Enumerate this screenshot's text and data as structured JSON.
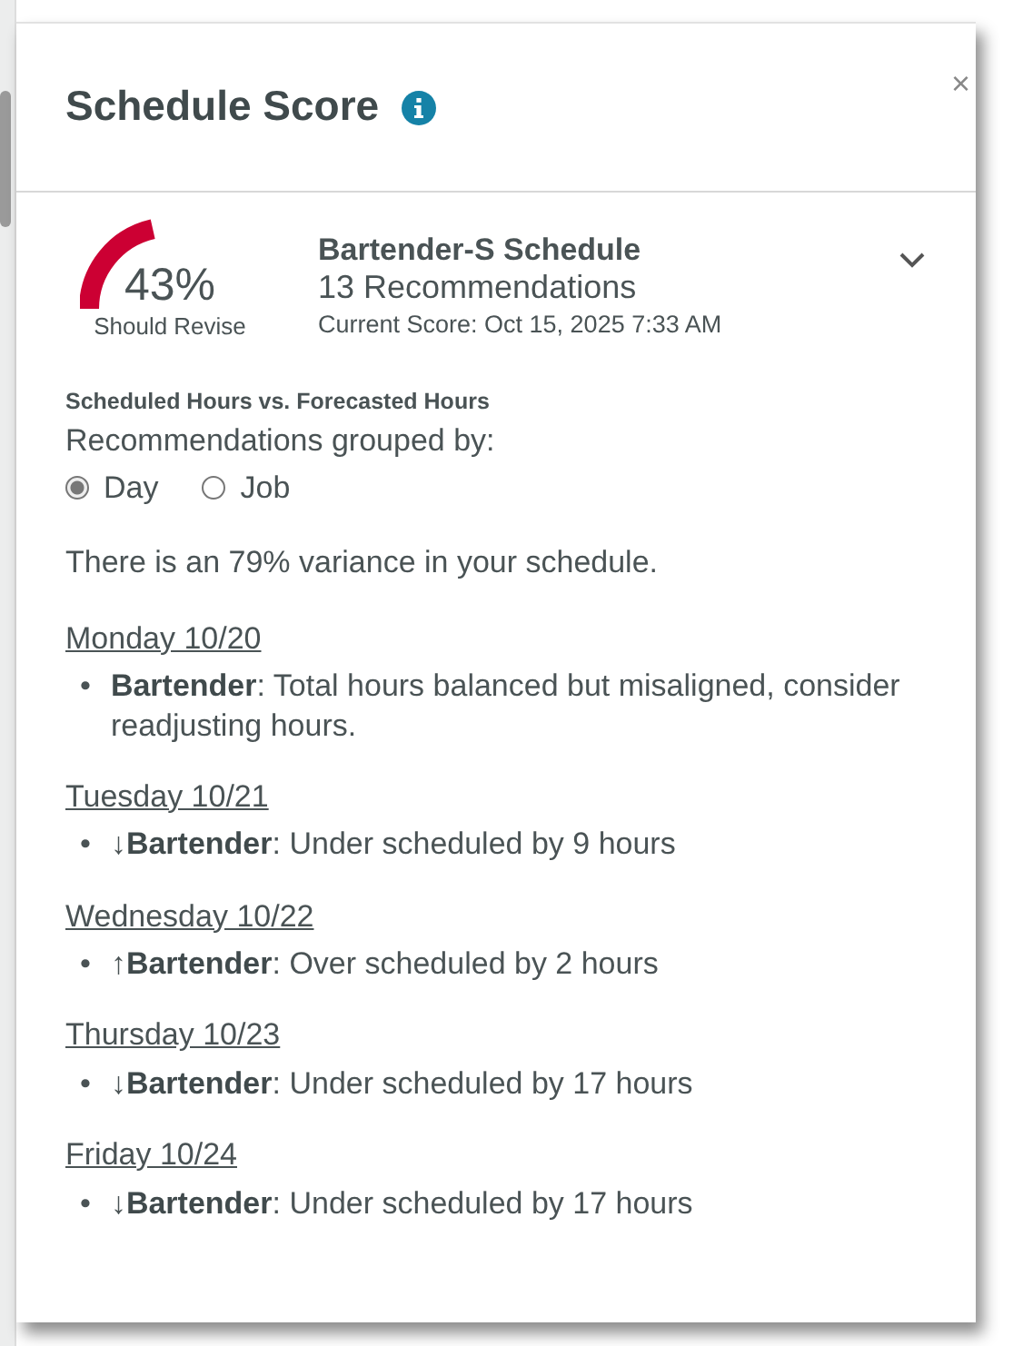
{
  "panel": {
    "title": "Schedule Score",
    "close": "×"
  },
  "score": {
    "percent": "43%",
    "rating": "Should Revise",
    "schedule_name": "Bartender-S Schedule",
    "recommendations": "13 Recommendations",
    "current_score": "Current Score: Oct 15, 2025 7:33 AM",
    "expanded": false
  },
  "section_title": "Scheduled Hours vs. Forecasted Hours",
  "group_label": "Recommendations grouped by:",
  "group_options": [
    {
      "label": "Day",
      "selected": true
    },
    {
      "label": "Job",
      "selected": false
    }
  ],
  "variance": "There is an 79% variance in your schedule.",
  "days": [
    {
      "date": "Monday 10/20",
      "items": [
        {
          "bullet": "•",
          "text": "**Bartender**: Total hours balanced but misaligned, consider readjusting hours."
        }
      ]
    },
    {
      "date": "Tuesday 10/21",
      "items": [
        {
          "bullet": "•",
          "text": "↓**Bartender**: Under scheduled by 9 hours"
        }
      ]
    },
    {
      "date": "Wednesday 10/22",
      "items": [
        {
          "bullet": "•",
          "text": "↑**Bartender**: Over scheduled by 2 hours"
        }
      ]
    },
    {
      "date": "Thursday 10/23",
      "items": [
        {
          "bullet": "•",
          "text": "↓**Bartender**: Under scheduled by 17 hours"
        }
      ]
    },
    {
      "date": "Friday 10/24",
      "items": [
        {
          "bullet": "•",
          "text": "↓**Bartender**: Under scheduled by 17 hours"
        }
      ]
    }
  ]
}
